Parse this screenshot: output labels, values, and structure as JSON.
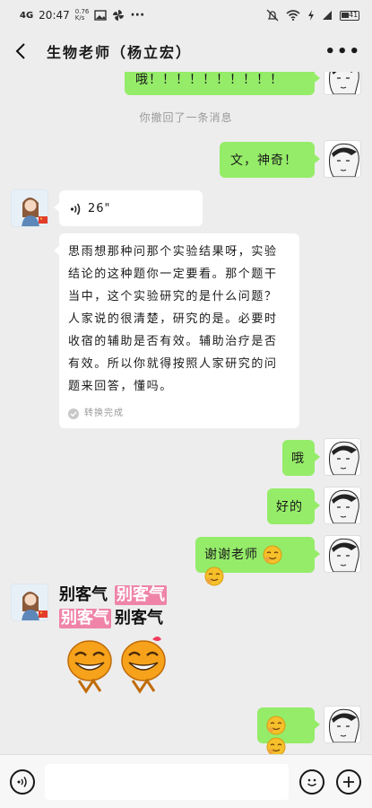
{
  "status_bar": {
    "network": "4G",
    "time": "20:47",
    "speed_top": "0.76",
    "speed_bottom": "K/s",
    "battery": "41"
  },
  "header": {
    "title": "生物老师（杨立宏）",
    "more": "•••"
  },
  "messages": {
    "m1_text": "哦！！！！！！！！！！",
    "recall_notice": "你撤回了一条消息",
    "m2_text": "文，神奇！",
    "voice_duration": "26\"",
    "transcript": "思雨想那种问那个实验结果呀，实验结论的这种题你一定要看。那个题干当中，这个实验研究的是什么问题？人家说的很清楚，研究的是。必要时收宿的辅助是否有效。辅助治疗是否有效。所以你就得按照人家研究的问题来回答，懂吗。",
    "transcribed_label": "转换完成",
    "m4_text": "哦",
    "m5_text": "好的",
    "m6_text": "谢谢老师",
    "sticker_word": "别客气"
  },
  "colors": {
    "sent_bubble": "#95ec69",
    "received_bubble": "#ffffff",
    "background": "#ededed",
    "sticker_pink": "#ef84a8",
    "emoji_yellow": "#f5c02a"
  },
  "icons": {
    "back": "chevron-left-icon",
    "more": "more-dots-icon",
    "voice_input": "voice-icon",
    "emoji_picker": "smiley-icon",
    "add": "plus-icon"
  }
}
